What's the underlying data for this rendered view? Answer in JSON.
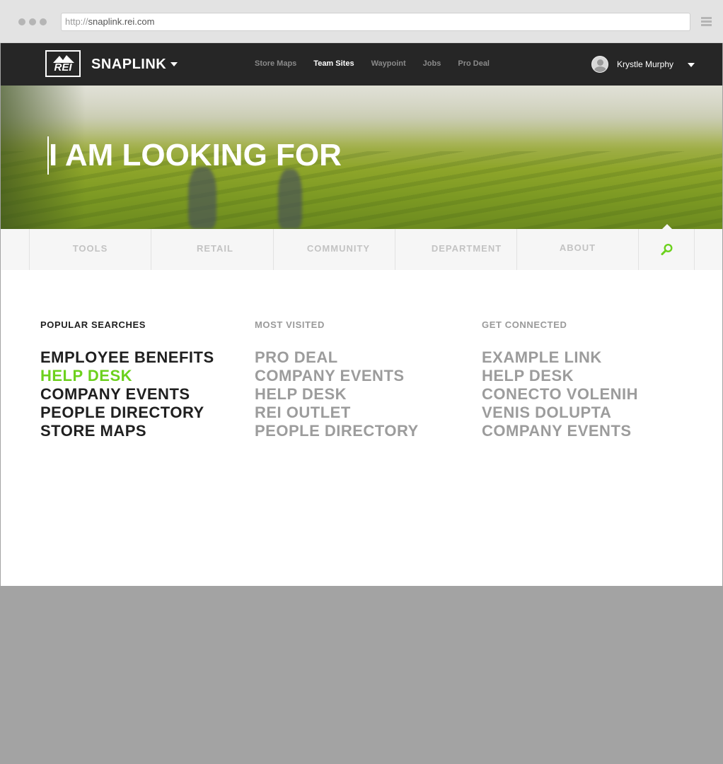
{
  "browser": {
    "url_protocol": "http://",
    "url_host": "snaplink.rei.com"
  },
  "header": {
    "logo_text": "REI",
    "brand": "SNAPLINK",
    "nav": [
      "Store Maps",
      "Team Sites",
      "Waypoint",
      "Jobs",
      "Pro Deal"
    ],
    "active_nav": "Team Sites",
    "user_name": "Krystle Murphy"
  },
  "hero": {
    "title": "I AM LOOKING FOR"
  },
  "tabs": [
    "TOOLS",
    "RETAIL",
    "COMMUNITY",
    "DEPARTMENT",
    "ABOUT"
  ],
  "columns": {
    "popular": {
      "heading": "POPULAR SEARCHES",
      "items": [
        "EMPLOYEE BENEFITS",
        "HELP DESK",
        "COMPANY EVENTS",
        "PEOPLE DIRECTORY",
        "STORE MAPS"
      ],
      "highlighted_item": "HELP DESK"
    },
    "visited": {
      "heading": "MOST VISITED",
      "items": [
        "PRO DEAL",
        "COMPANY EVENTS",
        "HELP DESK",
        "REI OUTLET",
        "PEOPLE DIRECTORY"
      ]
    },
    "connected": {
      "heading": "GET CONNECTED",
      "items": [
        "EXAMPLE LINK",
        "HELP DESK",
        "CONECTO VOLENIH",
        "VENIS DOLUPTA",
        "COMPANY EVENTS"
      ]
    }
  },
  "colors": {
    "accent_green": "#6cd11d",
    "nav_bg": "#262626",
    "footer_gray": "#a3a3a3"
  }
}
